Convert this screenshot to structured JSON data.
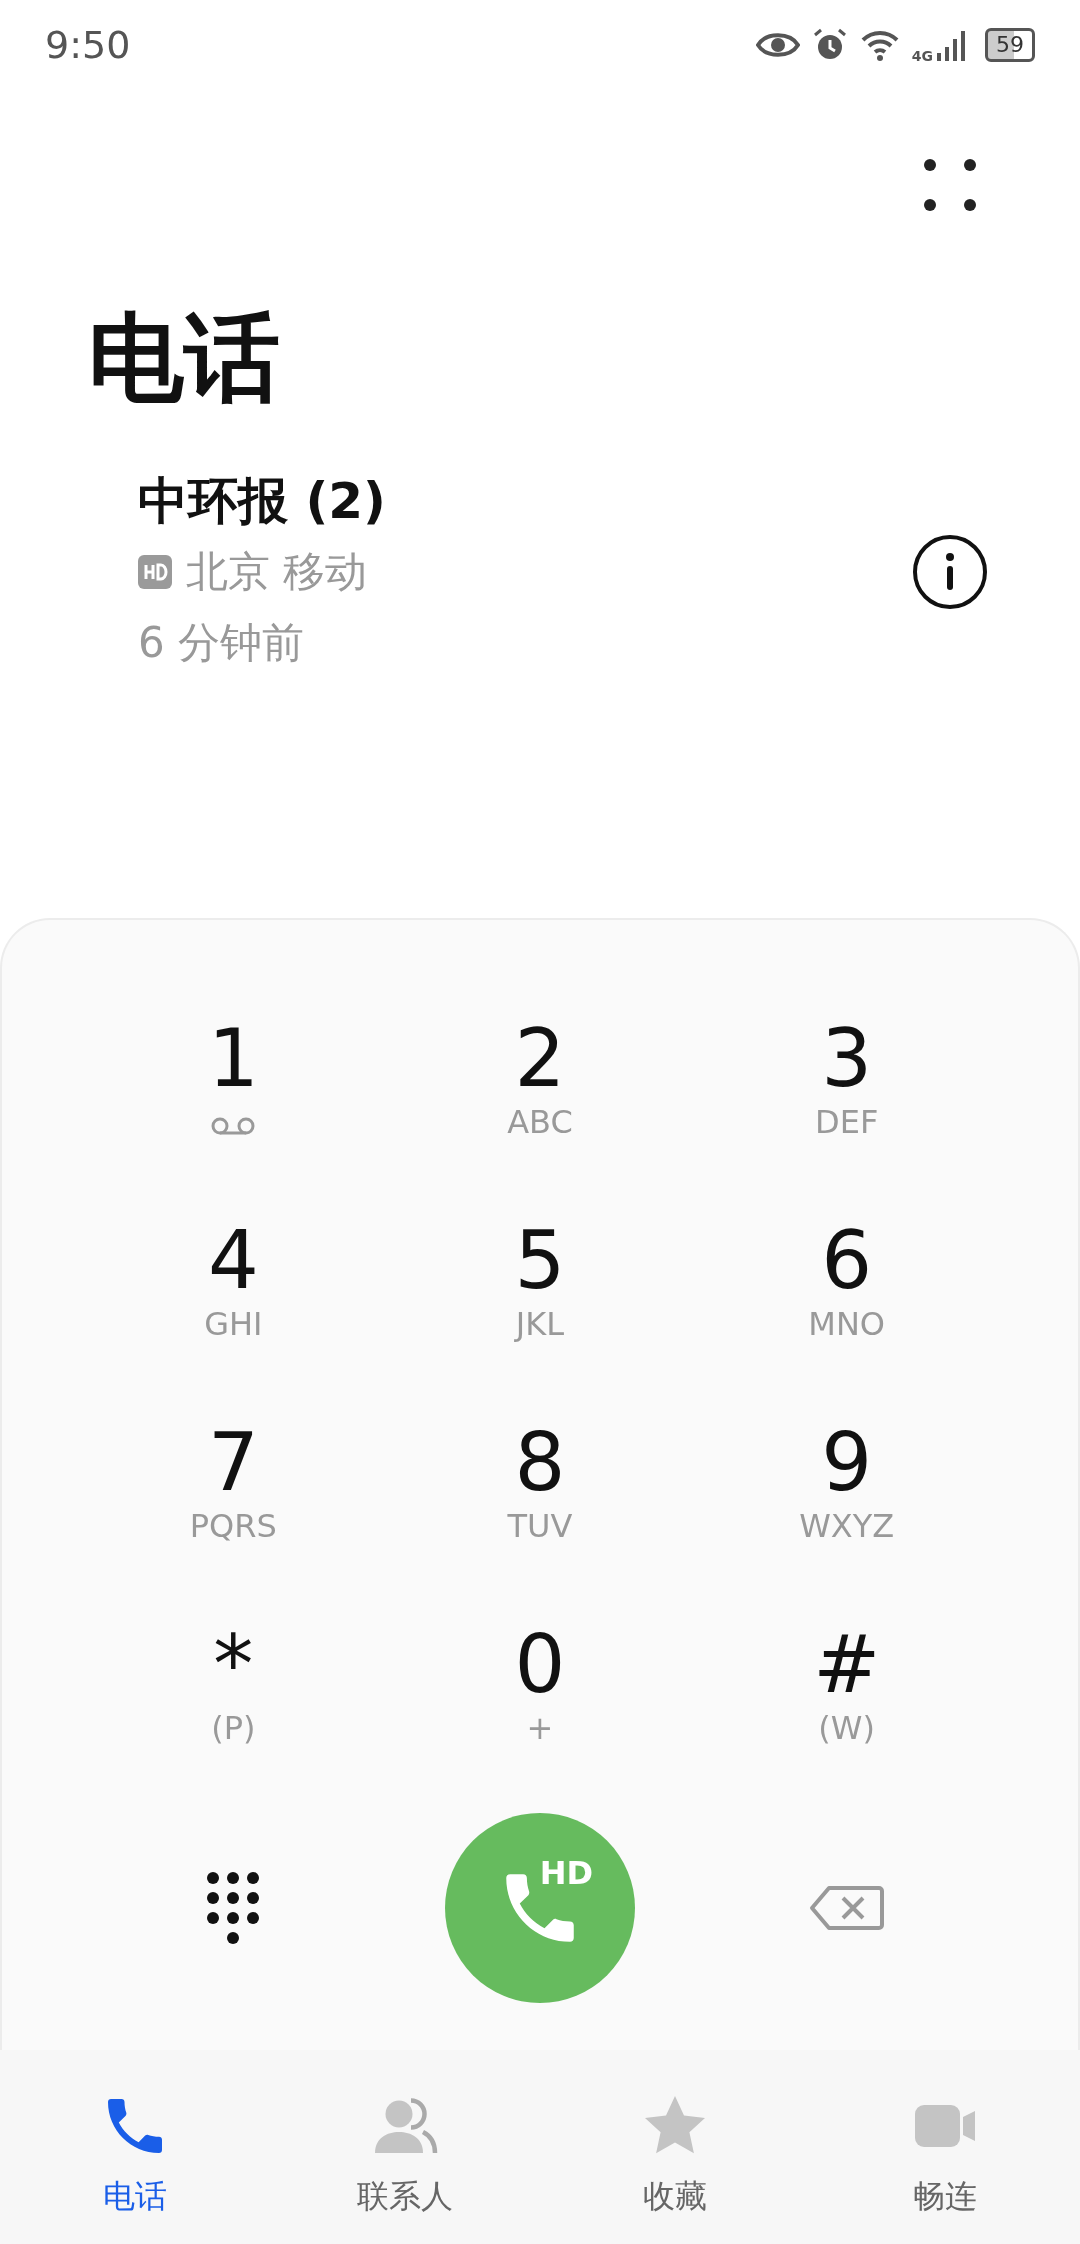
{
  "status_bar": {
    "time": "9:50",
    "network": "4G",
    "battery": "59"
  },
  "title": "电话",
  "call_log": [
    {
      "name": "中环报 (2)",
      "hd": true,
      "location": "北京 移动",
      "time": "6 分钟前"
    }
  ],
  "keypad": [
    {
      "digit": "1",
      "kind": "voicemail"
    },
    {
      "digit": "2",
      "kind": "letters",
      "sub": "ABC"
    },
    {
      "digit": "3",
      "kind": "letters",
      "sub": "DEF"
    },
    {
      "digit": "4",
      "kind": "letters",
      "sub": "GHI"
    },
    {
      "digit": "5",
      "kind": "letters",
      "sub": "JKL"
    },
    {
      "digit": "6",
      "kind": "letters",
      "sub": "MNO"
    },
    {
      "digit": "7",
      "kind": "letters",
      "sub": "PQRS"
    },
    {
      "digit": "8",
      "kind": "letters",
      "sub": "TUV"
    },
    {
      "digit": "9",
      "kind": "letters",
      "sub": "WXYZ"
    },
    {
      "digit": "*",
      "kind": "letters",
      "sub": "(P)"
    },
    {
      "digit": "0",
      "kind": "letters",
      "sub": "+"
    },
    {
      "digit": "#",
      "kind": "letters",
      "sub": "(W)"
    }
  ],
  "call_button": {
    "badge": "HD"
  },
  "nav": [
    {
      "label": "电话",
      "kind": "phone",
      "selected": true
    },
    {
      "label": "联系人",
      "kind": "contacts",
      "selected": false
    },
    {
      "label": "收藏",
      "kind": "star",
      "selected": false
    },
    {
      "label": "畅连",
      "kind": "video",
      "selected": false
    }
  ]
}
